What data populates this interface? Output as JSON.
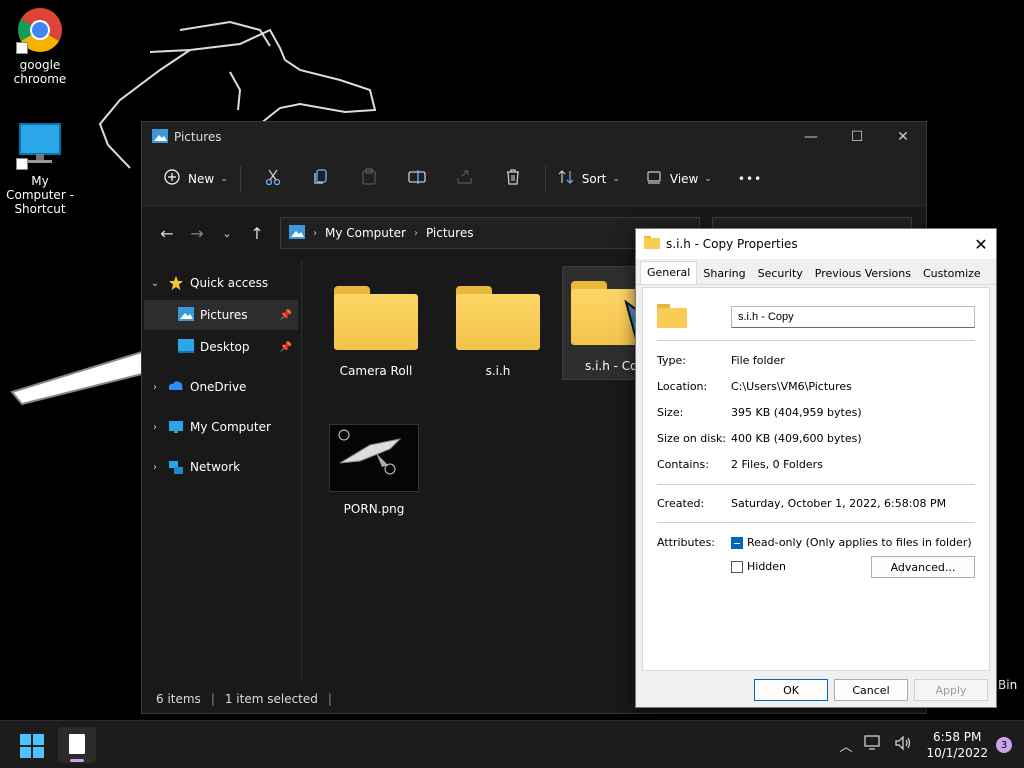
{
  "desktop": {
    "icons": [
      {
        "label": "google chroome",
        "icon": "chrome-icon"
      },
      {
        "label": "My Computer - Shortcut",
        "icon": "monitor-icon"
      }
    ],
    "recycle_label": "Bin"
  },
  "explorer": {
    "title": "Pictures",
    "controls": {
      "minimize": "—",
      "maximize": "☐",
      "close": "✕"
    },
    "commands": {
      "new_label": "New",
      "sort_label": "Sort",
      "view_label": "View",
      "more_label": "•••"
    },
    "breadcrumb": [
      "My Computer",
      "Pictures"
    ],
    "nav": {
      "quick_access": "Quick access",
      "pictures": "Pictures",
      "desktop": "Desktop",
      "onedrive": "OneDrive",
      "my_computer": "My Computer",
      "network": "Network"
    },
    "files": [
      {
        "name": "Camera Roll",
        "type": "folder"
      },
      {
        "name": "s.i.h",
        "type": "folder"
      },
      {
        "name": "s.i.h - Copy",
        "type": "folder",
        "selected": true
      },
      {
        "name": "PORN.png",
        "type": "image"
      }
    ],
    "status": {
      "items": "6 items",
      "selected": "1 item selected"
    }
  },
  "properties": {
    "title": "s.i.h - Copy Properties",
    "tabs": [
      "General",
      "Sharing",
      "Security",
      "Previous Versions",
      "Customize"
    ],
    "active_tab": "General",
    "name_value": "s.i.h - Copy",
    "type_label": "Type:",
    "type_value": "File folder",
    "location_label": "Location:",
    "location_value": "C:\\Users\\VM6\\Pictures",
    "size_label": "Size:",
    "size_value": "395 KB (404,959 bytes)",
    "size_on_disk_label": "Size on disk:",
    "size_on_disk_value": "400 KB (409,600 bytes)",
    "contains_label": "Contains:",
    "contains_value": "2 Files, 0 Folders",
    "created_label": "Created:",
    "created_value": "Saturday, October 1, 2022, 6:58:08 PM",
    "attributes_label": "Attributes:",
    "readonly_label": "Read-only (Only applies to files in folder)",
    "hidden_label": "Hidden",
    "advanced_label": "Advanced...",
    "ok_label": "OK",
    "cancel_label": "Cancel",
    "apply_label": "Apply"
  },
  "taskbar": {
    "time": "6:58 PM",
    "date": "10/1/2022",
    "notification_count": "3"
  },
  "colors": {
    "accent": "#0067c0",
    "folder": "#f8cc55",
    "taskbar": "#1c1c1c"
  }
}
